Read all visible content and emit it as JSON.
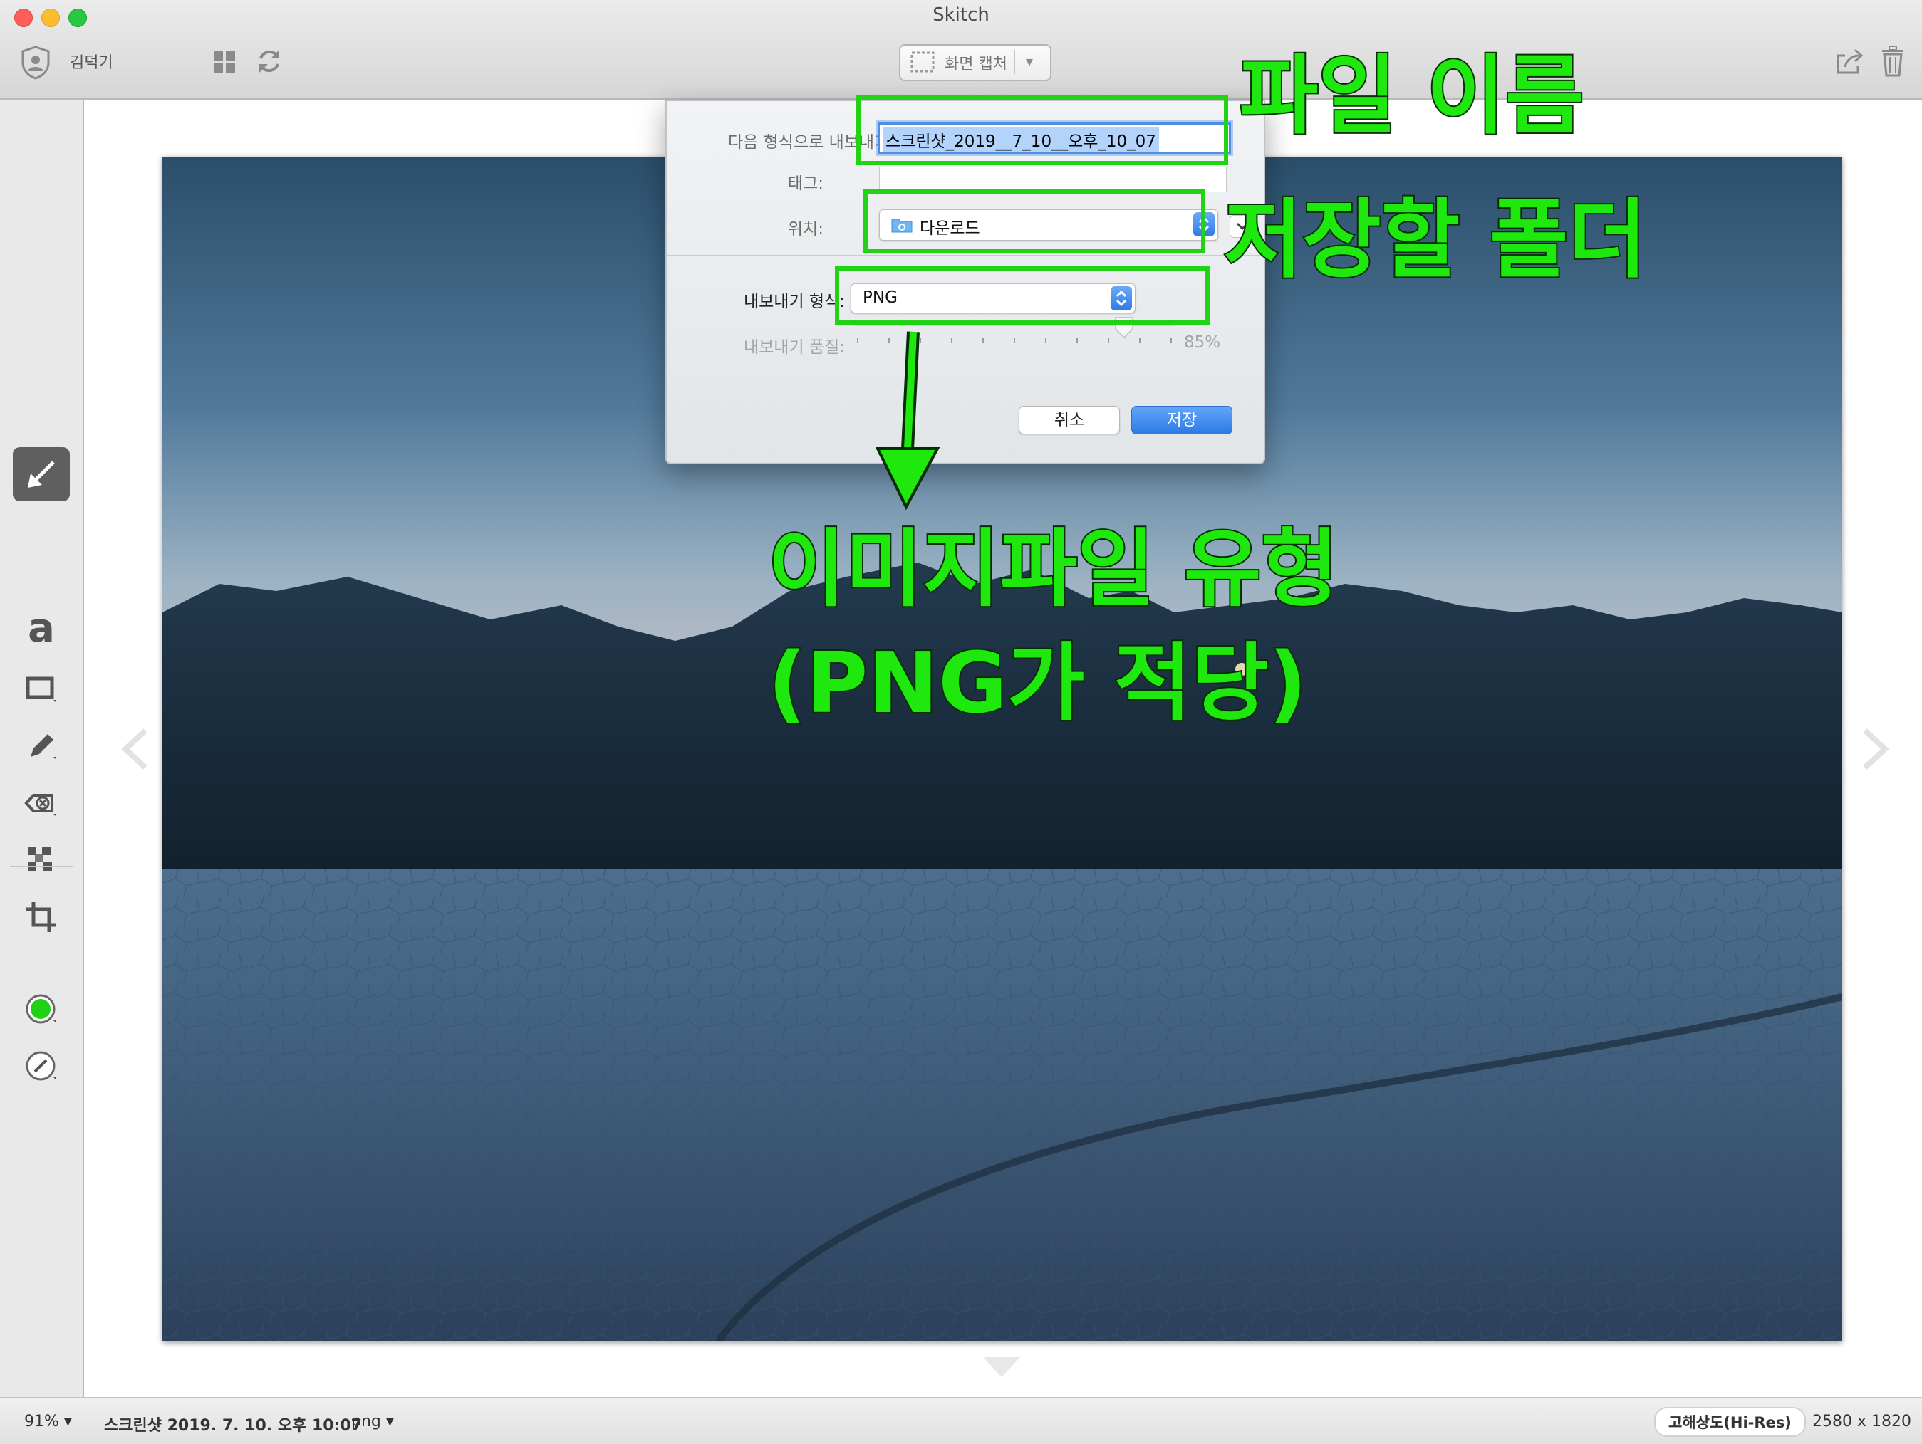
{
  "window": {
    "title": "Skitch",
    "colors": {
      "close": "#fc5f57",
      "minimize": "#fdbc2e",
      "zoom": "#29c840",
      "annotation_green": "#1ee80e"
    }
  },
  "toolbar": {
    "user_icon": "user-shield-icon",
    "user_name": "김덕기",
    "grid_icon": "grid-icon",
    "sync_icon": "sync-icon",
    "capture_label": "화면 캡처",
    "share_icon": "share-icon",
    "trash_icon": "trash-icon"
  },
  "tools": [
    {
      "name": "arrow",
      "icon": "arrow-tool-icon",
      "active": true
    },
    {
      "name": "text",
      "icon": "text-tool-icon",
      "label": "a"
    },
    {
      "name": "rectangle",
      "icon": "rectangle-tool-icon"
    },
    {
      "name": "pen",
      "icon": "pen-tool-icon"
    },
    {
      "name": "stamp",
      "icon": "stamp-tool-icon"
    },
    {
      "name": "pixelate",
      "icon": "pixelate-tool-icon"
    },
    {
      "name": "crop",
      "icon": "crop-tool-icon"
    },
    {
      "name": "color",
      "icon": "color-picker-icon",
      "color": "#21d115"
    },
    {
      "name": "size",
      "icon": "stroke-size-icon"
    }
  ],
  "dialog": {
    "export_as_label": "다음 형식으로 내보내기:",
    "filename": "스크린샷_2019__7_10__오후_10_07",
    "tags_label": "태그:",
    "tags_value": "",
    "where_label": "위치:",
    "where_value": "다운로드",
    "format_label": "내보내기 형식:",
    "format_value": "PNG",
    "quality_label": "내보내기 품질:",
    "quality_value": "85%",
    "quality_fraction": 0.85,
    "cancel_label": "취소",
    "save_label": "저장"
  },
  "annotations": {
    "filename": "파일 이름",
    "folder": "저장할 폴더",
    "filetype_line1": "이미지파일 유형",
    "filetype_line2": "(PNG가 적당)"
  },
  "statusbar": {
    "zoom": "91%",
    "file_name": "스크린샷 2019. 7. 10. 오후 10:07",
    "file_ext": ".png",
    "resolution_badge": "고해상도(Hi-Res)",
    "dimensions": "2580 x 1820"
  }
}
